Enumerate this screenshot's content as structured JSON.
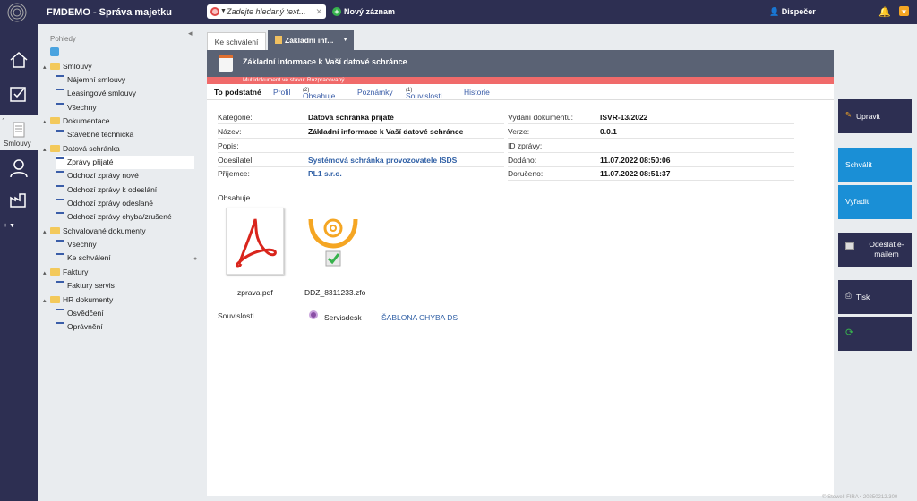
{
  "header": {
    "app_title": "FMDEMO - Správa majetku",
    "search_placeholder": "Zadejte hledaný text...",
    "new_record": "Nový záznam",
    "user": "Dispečer"
  },
  "nav": {
    "active_badge": "1",
    "active_label": "Smlouvy"
  },
  "tree": {
    "views_label": "Pohledy",
    "nodes": {
      "smlouvy": "Smlouvy",
      "najemni": "Nájemní smlouvy",
      "leasingove": "Leasingové smlouvy",
      "vsechny1": "Všechny",
      "dokumentace": "Dokumentace",
      "stavebni": "Stavebně technická",
      "datova": "Datová schránka",
      "prijate": "Zprávy přijaté",
      "odchozi_nove": "Odchozí zprávy nové",
      "odchozi_odeslani": "Odchozí zprávy k odeslání",
      "odchozi_odeslane": "Odchozí zprávy odeslané",
      "odchozi_chyba": "Odchozí zprávy chyba/zrušené",
      "schvalovane": "Schvalované dokumenty",
      "vsechny2": "Všechny",
      "ke_schvaleni": "Ke schválení",
      "faktury": "Faktury",
      "faktury_servis": "Faktury servis",
      "hr": "HR dokumenty",
      "osvedceni": "Osvědčení",
      "opravneni": "Oprávnění"
    }
  },
  "tabs": {
    "tab1": "Ke schválení",
    "tab2": "Základní inf..."
  },
  "doc": {
    "title": "Základní informace k Vaší datové schránce",
    "status": "Multidokument ve stavu: Rozpracovaný"
  },
  "subtabs": {
    "main": "To podstatné",
    "profil": "Profil",
    "obsahuje": "Obsahuje",
    "obsahuje_count": "(2)",
    "poznamky": "Poznámky",
    "souvislosti": "Souvislosti",
    "souvislosti_count": "(1)",
    "historie": "Historie"
  },
  "fields": {
    "kategorie_l": "Kategorie:",
    "kategorie_v": "Datová schránka přijaté",
    "nazev_l": "Název:",
    "nazev_v": "Základní informace k Vaší datové schránce",
    "popis_l": "Popis:",
    "odesilatel_l": "Odesílatel:",
    "odesilatel_v": "Systémová schránka provozovatele ISDS",
    "prijemce_l": "Příjemce:",
    "prijemce_v": "PL1 s.r.o.",
    "vydani_l": "Vydání dokumentu:",
    "vydani_v": "ISVR-13/2022",
    "verze_l": "Verze:",
    "verze_v": "0.0.1",
    "idzpravy_l": "ID zprávy:",
    "dodano_l": "Dodáno:",
    "dodano_v": "11.07.2022 08:50:06",
    "doruceno_l": "Doručeno:",
    "doruceno_v": "11.07.2022 08:51:37"
  },
  "contains": {
    "label": "Obsahuje",
    "file1": "zprava.pdf",
    "file2": "DDZ_8311233.zfo"
  },
  "related": {
    "label": "Souvislosti",
    "item1": "Servisdesk",
    "item2": "ŠABLONA CHYBA DS"
  },
  "actions": {
    "upravit": "Upravit",
    "schvalit": "Schválit",
    "vyradit": "Vyřadit",
    "odeslat": "Odeslat e-mailem",
    "tisk": "Tisk"
  },
  "footer": "© Stowell FIRA • 20250212.300"
}
